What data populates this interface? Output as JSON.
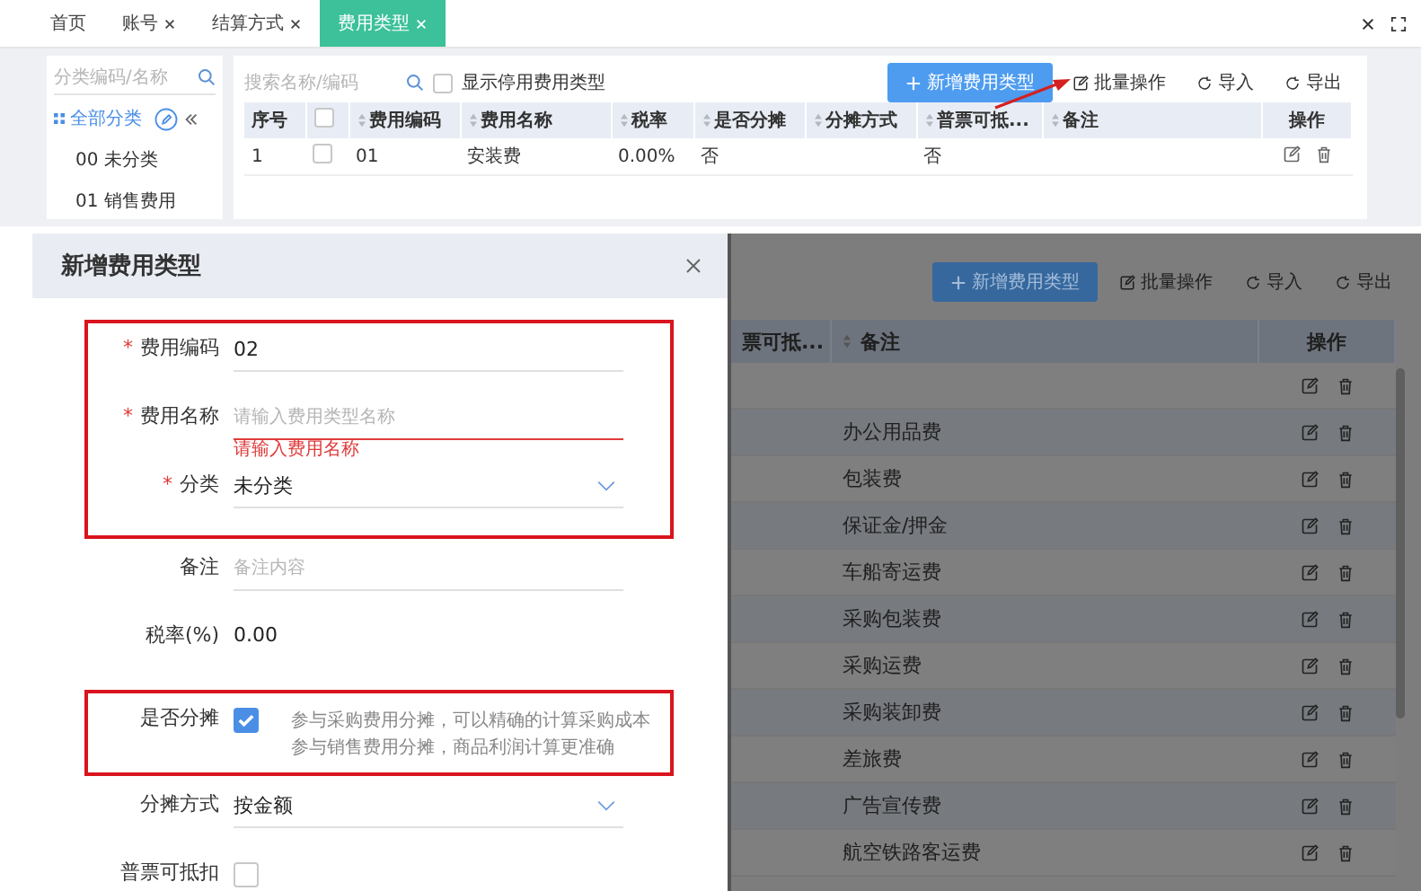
{
  "tabs": [
    {
      "label": "首页",
      "closable": false,
      "selected": false
    },
    {
      "label": "账号",
      "closable": true,
      "selected": false
    },
    {
      "label": "结算方式",
      "closable": true,
      "selected": false
    },
    {
      "label": "费用类型",
      "closable": true,
      "selected": true
    }
  ],
  "sidebar": {
    "search_placeholder": "分类编码/名称",
    "tree": [
      {
        "label": "全部分类",
        "selected": true,
        "children": [
          {
            "label": "00 未分类",
            "selected": false
          },
          {
            "label": "01 销售费用",
            "selected": false
          }
        ]
      }
    ]
  },
  "toolbar": {
    "search_placeholder": "搜索名称/编码",
    "show_disabled": {
      "label": "显示停用费用类型",
      "checked": false
    },
    "buttons": [
      {
        "label": "新增费用类型",
        "kind": "primary"
      },
      {
        "label": "批量操作",
        "kind": "batch"
      },
      {
        "label": "导入",
        "kind": "import"
      },
      {
        "label": "导出",
        "kind": "export"
      }
    ]
  },
  "table": {
    "columns": [
      {
        "label": "序号",
        "kind": "text",
        "sortable": false
      },
      {
        "kind": "checkbox",
        "checked": false
      },
      {
        "label": "费用编码",
        "kind": "text",
        "sortable": true
      },
      {
        "label": "费用名称",
        "kind": "text",
        "sortable": true
      },
      {
        "label": "税率",
        "kind": "text",
        "sortable": true
      },
      {
        "label": "是否分摊",
        "kind": "text",
        "sortable": true
      },
      {
        "label": "分摊方式",
        "kind": "text",
        "sortable": true
      },
      {
        "label": "普票可抵...",
        "kind": "text",
        "sortable": true
      },
      {
        "label": "备注",
        "kind": "text",
        "sortable": true
      },
      {
        "label": "操作",
        "kind": "actions",
        "sortable": false
      }
    ],
    "rows": [
      {
        "index": "1",
        "checked": false,
        "code": "01",
        "name": "安装费",
        "tax_rate": "0.00%",
        "allocate": "否",
        "deductible": "否"
      }
    ]
  },
  "dialog": {
    "title": "新增费用类型",
    "groups": [
      {
        "highlighted": true,
        "fields": [
          {
            "label": "费用编码",
            "kind": "input",
            "required_mark": "*",
            "value": "02"
          },
          {
            "label": "费用名称",
            "kind": "input",
            "required_mark": "*",
            "placeholder": "请输入费用类型名称",
            "error": "请输入费用名称"
          },
          {
            "label": "分类",
            "kind": "select",
            "required_mark": "*",
            "value": "未分类"
          }
        ]
      },
      {
        "highlighted": false,
        "fields": [
          {
            "label": "备注",
            "kind": "input",
            "placeholder": "备注内容"
          },
          {
            "label": "税率(%)",
            "kind": "text",
            "value": "0.00"
          }
        ]
      },
      {
        "highlighted": true,
        "fields": [
          {
            "label": "是否分摊",
            "kind": "checkbox",
            "checked": true,
            "hint": [
              "参与采购费用分摊，可以精确的计算采购成本",
              "参与销售费用分摊，商品利润计算更准确"
            ]
          }
        ]
      },
      {
        "highlighted": false,
        "fields": [
          {
            "label": "分摊方式",
            "kind": "select",
            "value": "按金额"
          },
          {
            "label": "普票可抵扣",
            "kind": "checkbox",
            "checked": false
          }
        ]
      }
    ]
  },
  "background": {
    "buttons": [
      {
        "label": "新增费用类型",
        "kind": "primary"
      },
      {
        "label": "批量操作",
        "kind": "batch"
      },
      {
        "label": "导入",
        "kind": "import"
      },
      {
        "label": "导出",
        "kind": "export"
      }
    ],
    "columns": [
      {
        "label": "票可抵...",
        "sortable": false
      },
      {
        "label": "备注",
        "sortable": true
      },
      {
        "label": "操作",
        "sortable": false
      }
    ],
    "rows": [
      {
        "kind": "empty"
      },
      {
        "kind": "note",
        "note": "办公用品费"
      },
      {
        "kind": "note",
        "note": "包装费"
      },
      {
        "kind": "note",
        "note": "保证金/押金"
      },
      {
        "kind": "note",
        "note": "车船寄运费"
      },
      {
        "kind": "note",
        "note": "采购包装费"
      },
      {
        "kind": "note",
        "note": "采购运费"
      },
      {
        "kind": "note",
        "note": "采购装卸费"
      },
      {
        "kind": "note",
        "note": "差旅费"
      },
      {
        "kind": "note",
        "note": "广告宣传费"
      },
      {
        "kind": "note",
        "note": "航空铁路客运费"
      }
    ]
  }
}
